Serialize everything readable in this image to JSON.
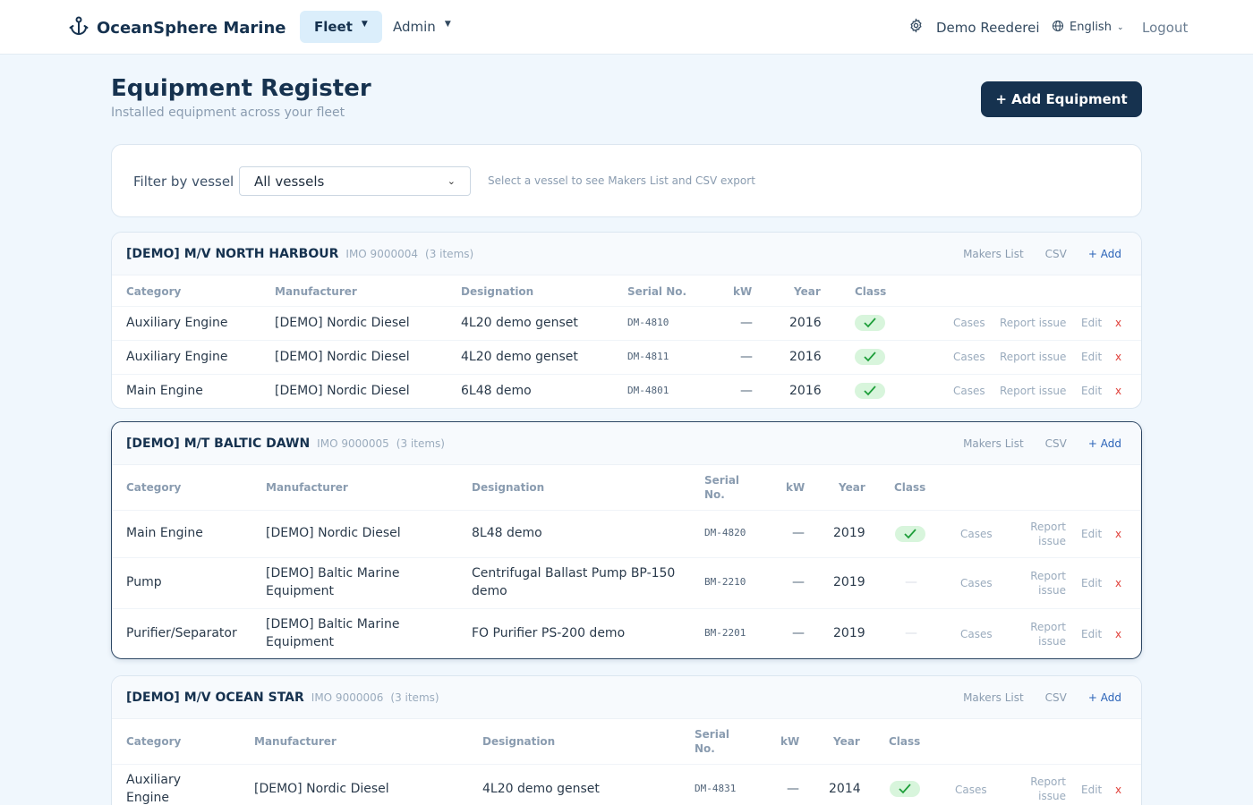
{
  "nav": {
    "brand": "OceanSphere Marine",
    "fleet": "Fleet",
    "admin": "Admin",
    "org": "Demo Reederei",
    "language": "English",
    "logout": "Logout"
  },
  "header": {
    "title": "Equipment Register",
    "subtitle": "Installed equipment across your fleet",
    "add_button": "+ Add Equipment"
  },
  "filter": {
    "label": "Filter by vessel",
    "selected": "All vessels",
    "hint": "Select a vessel to see Makers List and CSV export"
  },
  "columns": {
    "category": "Category",
    "manufacturer": "Manufacturer",
    "designation": "Designation",
    "serial": "Serial No.",
    "serial_l1": "Serial",
    "serial_l2": "No.",
    "kw": "kW",
    "year": "Year",
    "class": "Class"
  },
  "actions": {
    "makers_list": "Makers List",
    "csv": "CSV",
    "add": "+ Add",
    "cases": "Cases",
    "report_issue": "Report issue",
    "report_l1": "Report",
    "report_l2": "issue",
    "edit": "Edit",
    "delete": "x"
  },
  "vessels": [
    {
      "name": "[DEMO] M/V NORTH HARBOUR",
      "imo": "IMO 9000004",
      "count": "(3 items)",
      "rows": [
        {
          "category": "Auxiliary Engine",
          "manufacturer": "[DEMO] Nordic Diesel",
          "designation": "4L20 demo genset",
          "serial": "DM-4810",
          "kw": "—",
          "year": "2016",
          "class": true
        },
        {
          "category": "Auxiliary Engine",
          "manufacturer": "[DEMO] Nordic Diesel",
          "designation": "4L20 demo genset",
          "serial": "DM-4811",
          "kw": "—",
          "year": "2016",
          "class": true
        },
        {
          "category": "Main Engine",
          "manufacturer": "[DEMO] Nordic Diesel",
          "designation": "6L48 demo",
          "serial": "DM-4801",
          "kw": "—",
          "year": "2016",
          "class": true
        }
      ]
    },
    {
      "name": "[DEMO] M/T BALTIC DAWN",
      "imo": "IMO 9000005",
      "count": "(3 items)",
      "rows": [
        {
          "category": "Main Engine",
          "manufacturer": "[DEMO] Nordic Diesel",
          "designation": "8L48 demo",
          "serial": "DM-4820",
          "kw": "—",
          "year": "2019",
          "class": true
        },
        {
          "category": "Pump",
          "manufacturer_l1": "[DEMO] Baltic Marine",
          "manufacturer_l2": "Equipment",
          "designation_l1": "Centrifugal Ballast Pump BP-150",
          "designation_l2": "demo",
          "serial": "BM-2210",
          "kw": "—",
          "year": "2019",
          "class": false,
          "class_text": "—"
        },
        {
          "category": "Purifier/Separator",
          "manufacturer_l1": "[DEMO] Baltic Marine",
          "manufacturer_l2": "Equipment",
          "designation": "FO Purifier PS-200 demo",
          "serial": "BM-2201",
          "kw": "—",
          "year": "2019",
          "class": false,
          "class_text": "—"
        }
      ]
    },
    {
      "name": "[DEMO] M/V OCEAN STAR",
      "imo": "IMO 9000006",
      "count": "(3 items)",
      "rows": [
        {
          "category_l1": "Auxiliary",
          "category_l2": "Engine",
          "manufacturer": "[DEMO] Nordic Diesel",
          "designation": "4L20 demo genset",
          "serial": "DM-4831",
          "kw": "—",
          "year": "2014",
          "class": true
        }
      ]
    }
  ],
  "colors": {
    "primary": "#16324f",
    "accent_bg": "#dbeefb",
    "page_bg": "#f0f7fd",
    "check_bg": "#d8f5dc",
    "check": "#1e9e3a",
    "delete": "#e0413b",
    "link": "#2a63b8"
  },
  "icons": [
    "anchor-icon",
    "gear-icon",
    "globe-icon",
    "chevron-down-icon",
    "checkmark-icon"
  ]
}
